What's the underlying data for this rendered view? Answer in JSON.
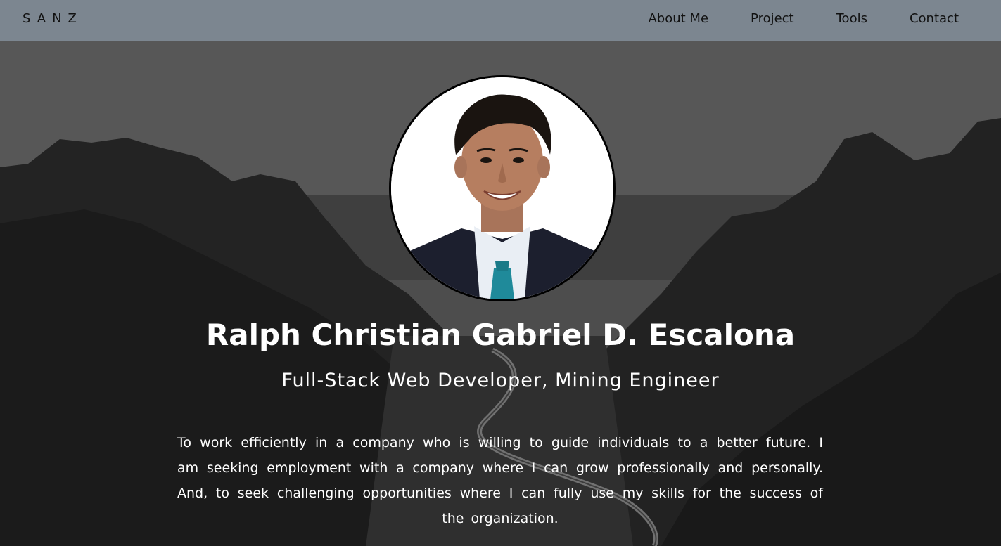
{
  "brand": "SANZ",
  "nav": {
    "items": [
      {
        "label": "About Me"
      },
      {
        "label": "Project"
      },
      {
        "label": "Tools"
      },
      {
        "label": "Contact"
      }
    ]
  },
  "hero": {
    "name": "Ralph Christian Gabriel D. Escalona",
    "role": "Full-Stack Web Developer, Mining Engineer",
    "objective": "To work efficiently in a company who is willing to guide individuals to a better future. I am seeking employment with a company where I can grow professionally and personally. And, to seek challenging opportunities where I can fully use my skills for the success of the organization."
  },
  "colors": {
    "navbar": "#7c8690",
    "text_light": "#ffffff",
    "text_dark": "#111111"
  }
}
